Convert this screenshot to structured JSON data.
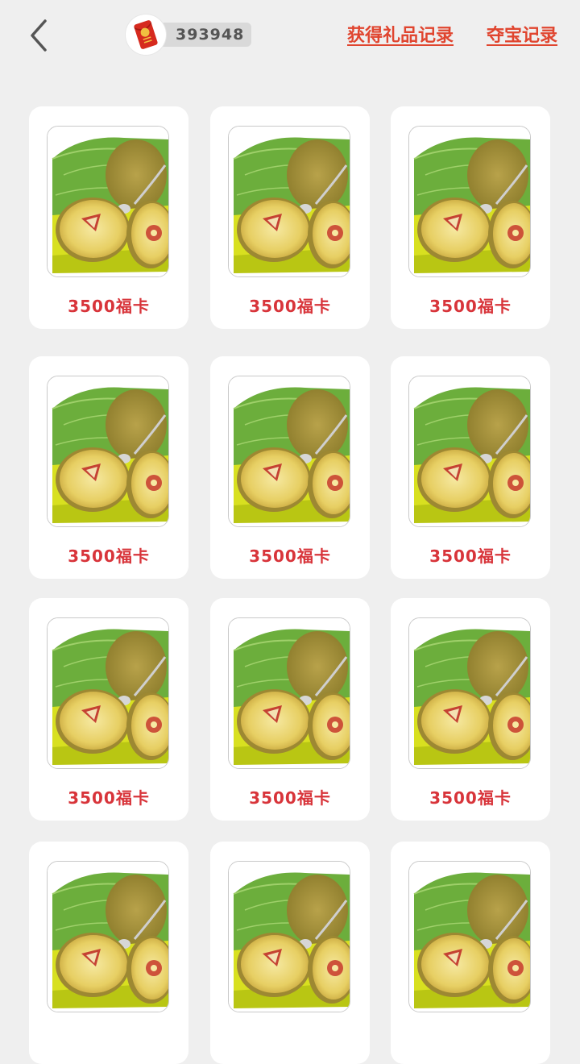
{
  "header": {
    "back_icon": "chevron-left-icon",
    "balance_icon": "red-envelope-icon",
    "balance": "393948",
    "gift_record_label": "获得礼品记录",
    "treasure_record_label": "夺宝记录"
  },
  "colors": {
    "accent": "#e0452f",
    "price": "#d8343a",
    "background": "#efefef",
    "card": "#ffffff"
  },
  "items": [
    {
      "image": "red-kiwi-fruit-image",
      "price": "3500福卡"
    },
    {
      "image": "red-kiwi-fruit-image",
      "price": "3500福卡"
    },
    {
      "image": "red-kiwi-fruit-image",
      "price": "3500福卡"
    },
    {
      "image": "red-kiwi-fruit-image",
      "price": "3500福卡"
    },
    {
      "image": "red-kiwi-fruit-image",
      "price": "3500福卡"
    },
    {
      "image": "red-kiwi-fruit-image",
      "price": "3500福卡"
    },
    {
      "image": "red-kiwi-fruit-image",
      "price": "3500福卡"
    },
    {
      "image": "red-kiwi-fruit-image",
      "price": "3500福卡"
    },
    {
      "image": "red-kiwi-fruit-image",
      "price": "3500福卡"
    },
    {
      "image": "red-kiwi-fruit-image",
      "price": ""
    },
    {
      "image": "red-kiwi-fruit-image",
      "price": ""
    },
    {
      "image": "red-kiwi-fruit-image",
      "price": ""
    }
  ]
}
